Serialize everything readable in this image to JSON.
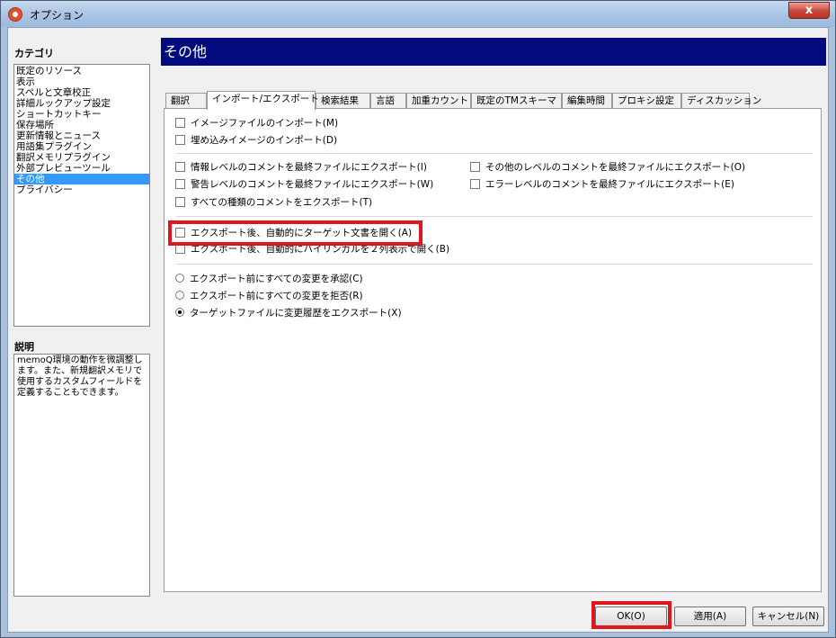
{
  "window": {
    "title": "オプション",
    "close_glyph": "x"
  },
  "left": {
    "category_heading": "カテゴリ",
    "categories": [
      "既定のリソース",
      "表示",
      "スペルと文章校正",
      "詳細ルックアップ設定",
      "ショートカットキー",
      "保存場所",
      "更新情報とニュース",
      "用語集プラグイン",
      "翻訳メモリプラグイン",
      "外部プレビューツール",
      "その他",
      "プライバシー"
    ],
    "selected_index": 10,
    "description_heading": "説明",
    "description": "memoQ環境の動作を微調整します。また、新規翻訳メモリで使用するカスタムフィールドを定義することもできます。"
  },
  "header": {
    "title": "その他"
  },
  "tabs": [
    "翻訳",
    "インポート/エクスポート",
    "検索結果",
    "言語",
    "加重カウント",
    "既定のTMスキーマ",
    "編集時間",
    "プロキシ設定",
    "ディスカッション"
  ],
  "active_tab_index": 1,
  "options": {
    "import_images": "イメージファイルのインポート(M)",
    "embedded_images": "埋め込みイメージのインポート(D)",
    "info_comments": "情報レベルのコメントを最終ファイルにエクスポート(I)",
    "other_comments": "その他のレベルのコメントを最終ファイルにエクスポート(O)",
    "warning_comments": "警告レベルのコメントを最終ファイルにエクスポート(W)",
    "error_comments": "エラーレベルのコメントを最終ファイルにエクスポート(E)",
    "all_comments": "すべての種類のコメントをエクスポート(T)",
    "open_target_after_export": "エクスポート後、自動的にターゲット文書を開く(A)",
    "open_bilingual_after_export": "エクスポート後、自動的にバイリンガルを２列表示で開く(B)",
    "radio_accept_changes": "エクスポート前にすべての変更を承認(C)",
    "radio_reject_changes": "エクスポート前にすべての変更を拒否(R)",
    "radio_export_history": "ターゲットファイルに変更履歴をエクスポート(X)",
    "radio_selected": "radio_export_history"
  },
  "buttons": {
    "ok": "OK(O)",
    "apply": "適用(A)",
    "cancel": "キャンセル(N)"
  },
  "colors": {
    "header_bg": "#020b7e",
    "selection_bg": "#3399ff",
    "highlight_red": "#e0161f"
  }
}
